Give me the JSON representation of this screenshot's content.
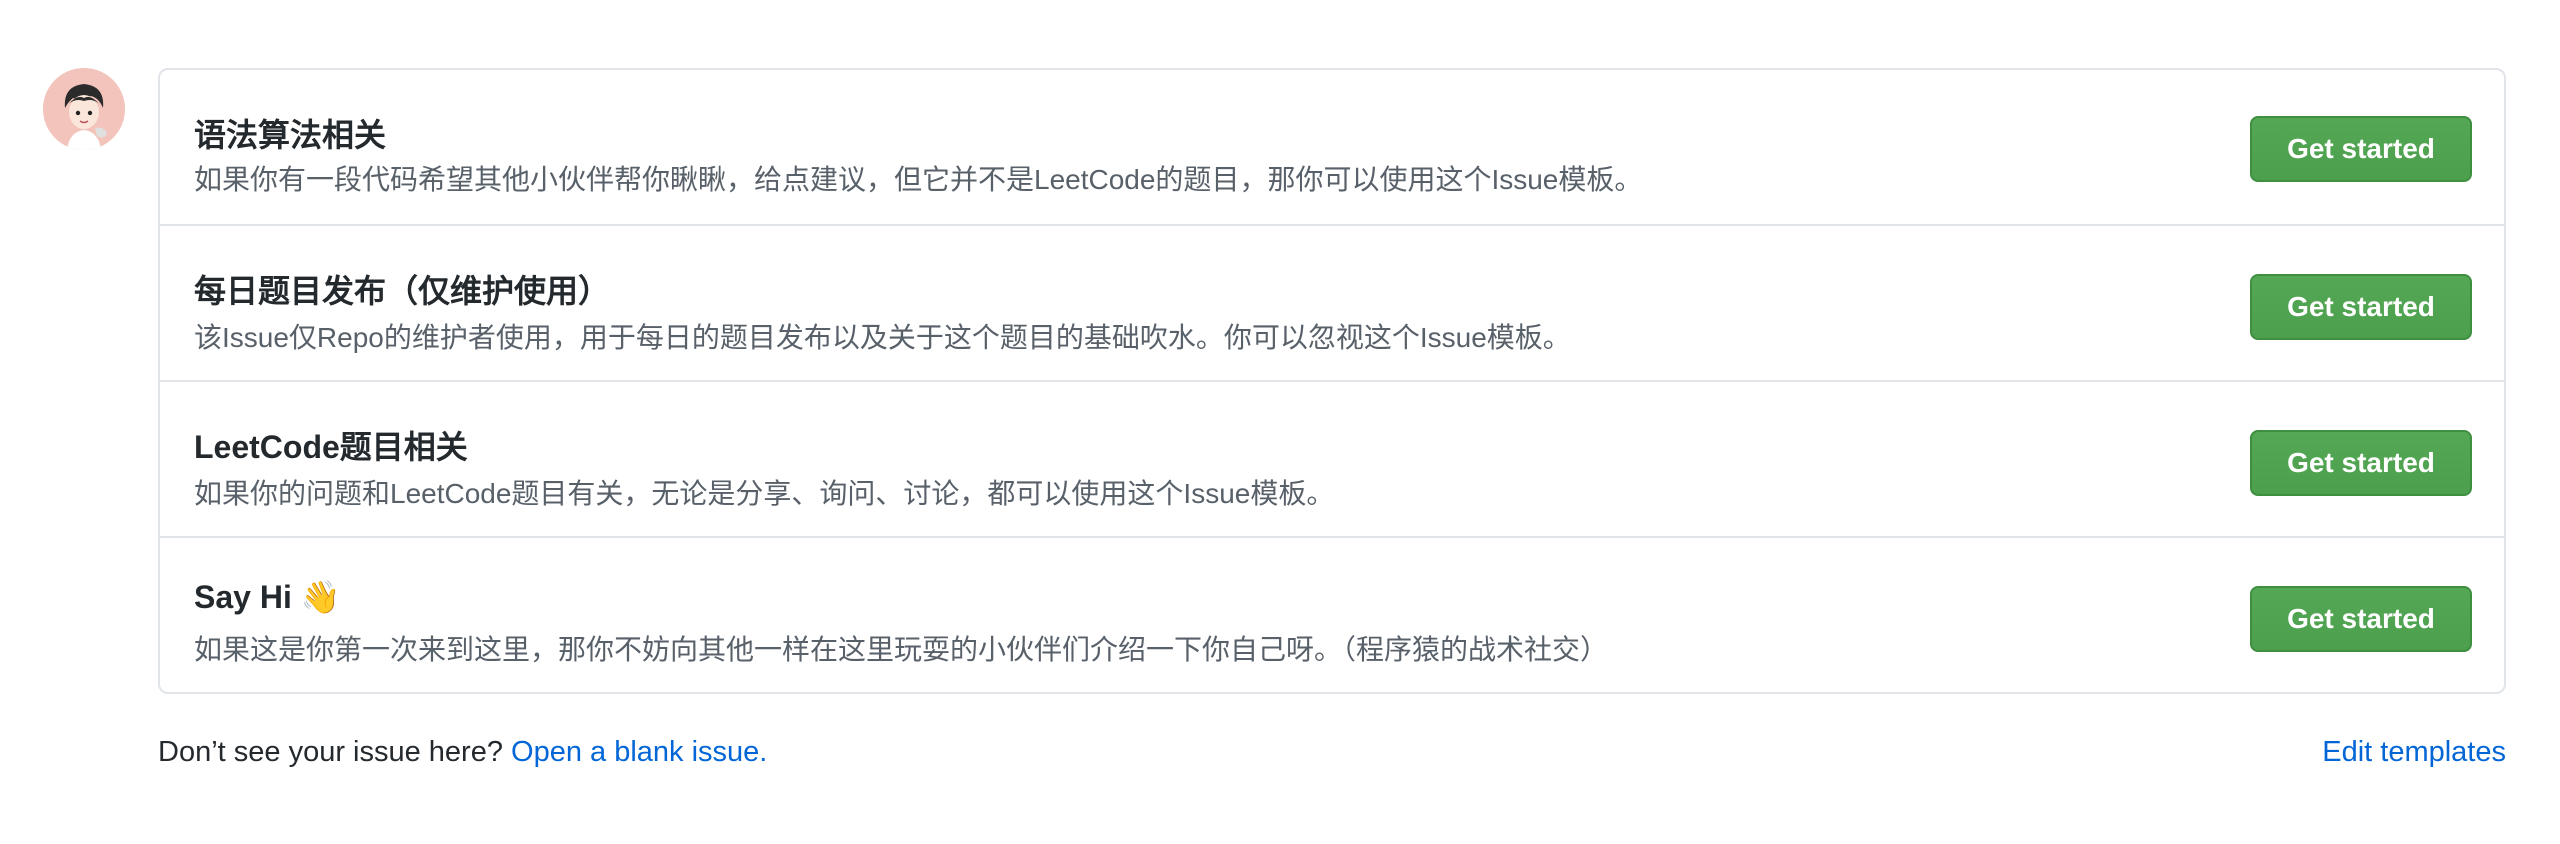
{
  "templates": [
    {
      "title": "语法算法相关",
      "description": "如果你有一段代码希望其他小伙伴帮你瞅瞅，给点建议，但它并不是LeetCode的题目，那你可以使用这个Issue模板。",
      "button_label": "Get started"
    },
    {
      "title": "每日题目发布（仅维护使用）",
      "description": "该Issue仅Repo的维护者使用，用于每日的题目发布以及关于这个题目的基础吹水。你可以忽视这个Issue模板。",
      "button_label": "Get started"
    },
    {
      "title": "LeetCode题目相关",
      "description": "如果你的问题和LeetCode题目有关，无论是分享、询问、讨论，都可以使用这个Issue模板。",
      "button_label": "Get started"
    },
    {
      "title": "Say Hi 👋",
      "description": "如果这是你第一次来到这里，那你不妨向其他一样在这里玩耍的小伙伴们介绍一下你自己呀。（程序猿的战术社交）",
      "button_label": "Get started"
    }
  ],
  "footer": {
    "prompt": "Don’t see your issue here?",
    "blank_issue_link": "Open a blank issue.",
    "edit_templates_link": "Edit templates"
  },
  "colors": {
    "button_green": "#4c9f4d",
    "link_blue": "#0366d6"
  }
}
